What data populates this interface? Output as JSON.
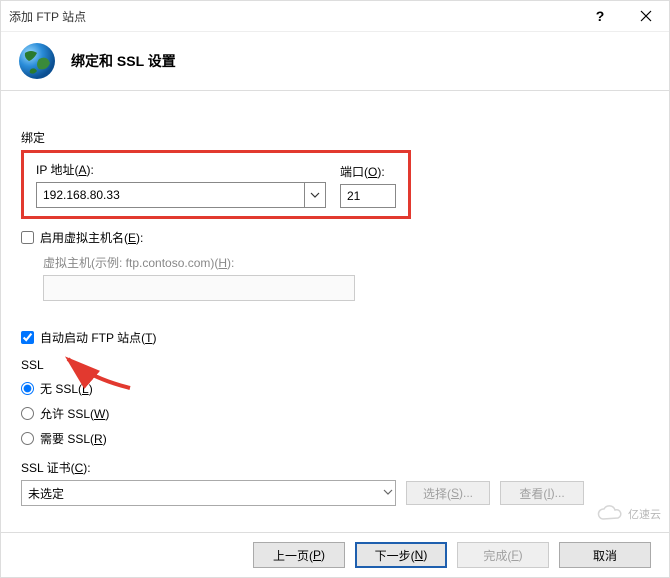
{
  "window": {
    "title": "添加 FTP 站点"
  },
  "header": {
    "heading": "绑定和 SSL 设置"
  },
  "binding": {
    "section_label": "绑定",
    "ip_label_pre": "IP 地址(",
    "ip_accel": "A",
    "ip_label_post": "):",
    "ip_value": "192.168.80.33",
    "port_label_pre": "端口(",
    "port_accel": "O",
    "port_label_post": "):",
    "port_value": "21"
  },
  "virtual_host": {
    "enable_label_pre": "启用虚拟主机名(",
    "enable_accel": "E",
    "enable_label_post": "):",
    "hint_label_pre": "虚拟主机(示例: ftp.contoso.com)(",
    "hint_accel": "H",
    "hint_label_post": "):"
  },
  "auto_start": {
    "label_pre": "自动启动 FTP 站点(",
    "accel": "T",
    "label_post": ")"
  },
  "ssl": {
    "section_label": "SSL",
    "none_pre": "无 SSL(",
    "none_accel": "L",
    "none_post": ")",
    "allow_pre": "允许 SSL(",
    "allow_accel": "W",
    "allow_post": ")",
    "require_pre": "需要 SSL(",
    "require_accel": "R",
    "require_post": ")",
    "selected": "none",
    "cert_label_pre": "SSL 证书(",
    "cert_accel": "C",
    "cert_label_post": "):",
    "cert_selected": "未选定",
    "select_btn_pre": "选择(",
    "select_btn_accel": "S",
    "select_btn_post": ")...",
    "view_btn_pre": "查看(",
    "view_btn_accel": "I",
    "view_btn_post": ")..."
  },
  "footer": {
    "prev_pre": "上一页(",
    "prev_accel": "P",
    "prev_post": ")",
    "next_pre": "下一步(",
    "next_accel": "N",
    "next_post": ")",
    "finish_pre": "完成(",
    "finish_accel": "F",
    "finish_post": ")",
    "cancel": "取消"
  },
  "watermark": {
    "text": "亿速云"
  }
}
